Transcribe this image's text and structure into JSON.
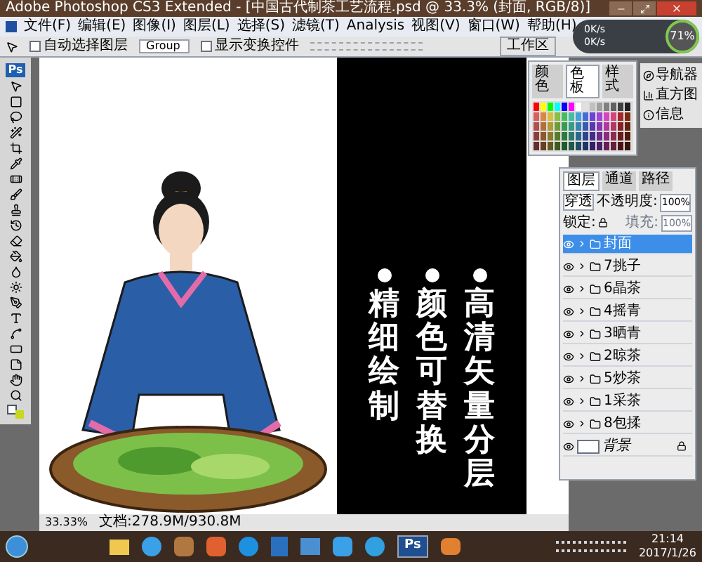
{
  "window": {
    "title": "Adobe Photoshop CS3 Extended - [中国古代制茶工艺流程.psd @ 33.3% (封面, RGB/8)]"
  },
  "menu": [
    "文件(F)",
    "编辑(E)",
    "图像(I)",
    "图层(L)",
    "选择(S)",
    "滤镜(T)",
    "Analysis",
    "视图(V)",
    "窗口(W)",
    "帮助(H)"
  ],
  "options_bar": {
    "auto_select": {
      "label": "自动选择图层",
      "checked": false
    },
    "auto_select_value": "Group",
    "transform_controls": {
      "label": "显示变换控件",
      "checked": false
    },
    "workspace": "工作区"
  },
  "toolbox": {
    "logo": "Ps"
  },
  "canvas": {
    "features": [
      "精细绘制",
      "颜色可替换",
      "高清矢量分层"
    ]
  },
  "swatches_panel": {
    "tabs": [
      {
        "label": "颜色",
        "selected": false
      },
      {
        "label": "色板",
        "selected": true
      },
      {
        "label": "样式",
        "selected": false
      }
    ]
  },
  "side_panel": {
    "items": [
      "导航器",
      "直方图",
      "信息"
    ]
  },
  "layers_panel": {
    "tabs": [
      {
        "label": "图层",
        "selected": true
      },
      {
        "label": "通道",
        "selected": false
      },
      {
        "label": "路径",
        "selected": false
      }
    ],
    "blend_mode": "穿透",
    "opacity_label": "不透明度:",
    "opacity": "100%",
    "lock_label": "锁定:",
    "fill_label": "填充:",
    "fill": "100%",
    "layers": [
      {
        "name": "封面",
        "kind": "group",
        "selected": true
      },
      {
        "name": "7挑子",
        "kind": "group",
        "selected": false
      },
      {
        "name": "6晶茶",
        "kind": "group",
        "selected": false
      },
      {
        "name": "4摇青",
        "kind": "group",
        "selected": false
      },
      {
        "name": "3晒青",
        "kind": "group",
        "selected": false
      },
      {
        "name": "2晾茶",
        "kind": "group",
        "selected": false
      },
      {
        "name": "5炒茶",
        "kind": "group",
        "selected": false
      },
      {
        "name": "1采茶",
        "kind": "group",
        "selected": false
      },
      {
        "name": "8包揉",
        "kind": "group",
        "selected": false
      },
      {
        "name": "背景",
        "kind": "background",
        "selected": false
      }
    ]
  },
  "status_bar": {
    "zoom": "33.33%",
    "document": "文档:278.9M/930.8M"
  },
  "monitor": {
    "upload": "0K/s",
    "download": "0K/s",
    "usage": "71%"
  },
  "taskbar": {
    "ps_label": "Ps",
    "time": "21:14",
    "date": "2017/1/26"
  }
}
